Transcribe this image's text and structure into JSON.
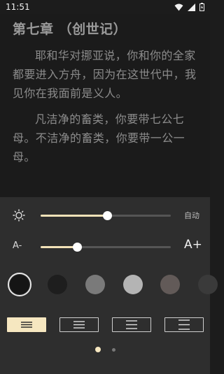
{
  "status": {
    "time": "11:51"
  },
  "reader": {
    "chapter_title": "第七章 （创世记）",
    "paragraphs": [
      "耶和华对挪亚说，你和你的全家都要进入方舟，因为在这世代中，我见你在我面前是义人。",
      "凡洁净的畜类，你要带七公七母。不洁净的畜类，你要带一公一母。"
    ]
  },
  "brightness": {
    "auto_label": "自动",
    "level": 0.51
  },
  "font_size": {
    "smaller_label": "A-",
    "larger_label": "A+",
    "level": 0.28
  },
  "themes": [
    {
      "name": "black",
      "color": "#151515",
      "selected": true
    },
    {
      "name": "dark",
      "color": "#1e1e1e",
      "selected": false
    },
    {
      "name": "grey",
      "color": "#7a7a7a",
      "selected": false
    },
    {
      "name": "light-grey",
      "color": "#b4b4b4",
      "selected": false
    },
    {
      "name": "brown",
      "color": "#625a58",
      "selected": false
    },
    {
      "name": "extra",
      "color": "#3a3a3a",
      "selected": false
    }
  ],
  "alignment": {
    "options": [
      "compact",
      "normal",
      "loose",
      "extra-loose"
    ],
    "selected": 0
  },
  "pager": {
    "pages": 2,
    "current": 0
  },
  "colors": {
    "accent": "#f2e2b8",
    "panel": "#2e2e2e",
    "reader_bg": "#1b1b1b"
  }
}
